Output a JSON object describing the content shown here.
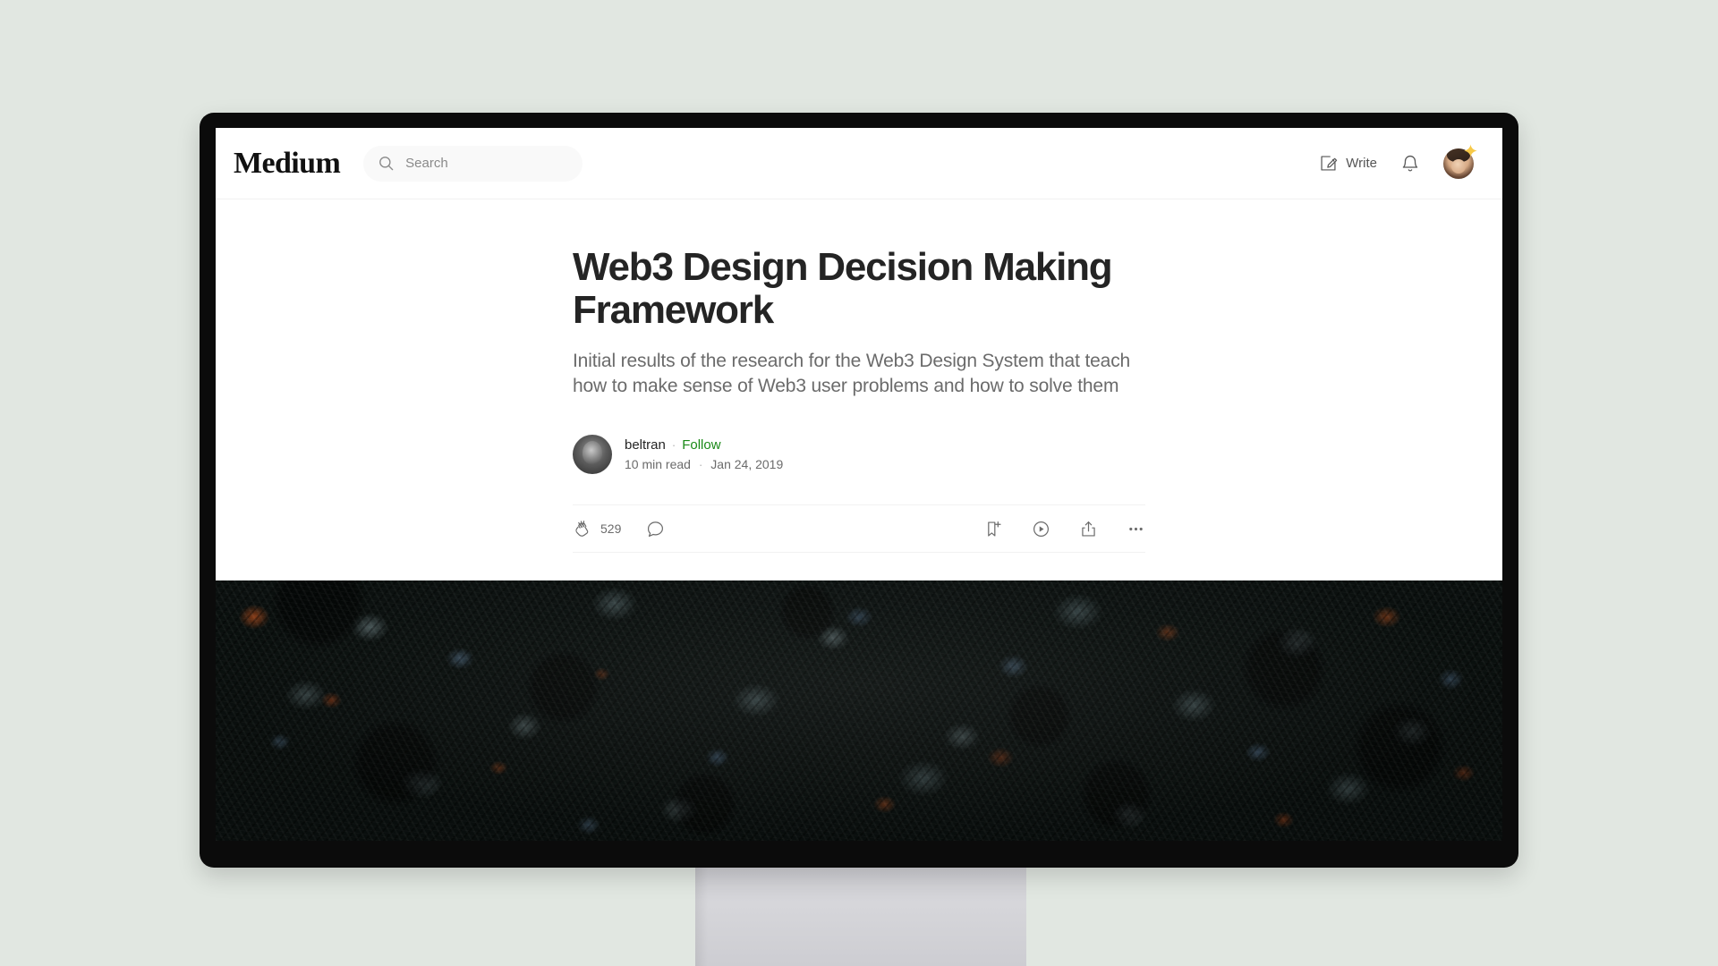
{
  "header": {
    "brand": "Medium",
    "search": {
      "placeholder": "Search",
      "value": "",
      "icon": "search-icon"
    },
    "write": {
      "label": "Write",
      "icon": "write-pencil-icon"
    },
    "notifications": {
      "icon": "bell-icon"
    },
    "avatar": {
      "name": "user-avatar",
      "badge_icon": "star-badge-icon"
    }
  },
  "article": {
    "title": "Web3 Design Decision Making Framework",
    "subtitle": "Initial results of the research for the Web3 Design System that teach how to make sense of Web3 user problems and how to solve them",
    "author": {
      "name": "beltran",
      "follow_label": "Follow",
      "separator": "·"
    },
    "meta": {
      "read_time": "10 min read",
      "separator": "·",
      "date": "Jan 24, 2019"
    },
    "actions": {
      "clap": {
        "icon": "clap-icon",
        "count": "529"
      },
      "comment": {
        "icon": "comment-bubble-icon"
      },
      "save": {
        "icon": "bookmark-plus-icon"
      },
      "listen": {
        "icon": "play-circle-icon"
      },
      "share": {
        "icon": "share-upload-icon"
      },
      "more": {
        "icon": "ellipsis-icon"
      }
    },
    "hero_image": {
      "name": "forest-canopy-aerial-photo"
    }
  },
  "colors": {
    "page_background": "#e1e7e1",
    "screen_background": "#ffffff",
    "bezel": "#0b0b0b",
    "stand": "#d3d3d8",
    "follow_green": "#1a8917",
    "title_text": "#242424",
    "muted_text": "#6b6b6b",
    "star_badge": "#f7c948"
  }
}
